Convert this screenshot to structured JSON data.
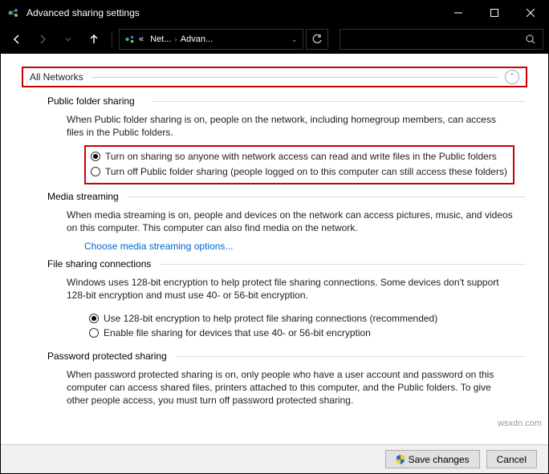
{
  "window": {
    "title": "Advanced sharing settings"
  },
  "breadcrumbs": {
    "prefix": "«",
    "net": "Net...",
    "advan": "Advan..."
  },
  "profile": {
    "label": "All Networks"
  },
  "public_folder": {
    "title": "Public folder sharing",
    "desc": "When Public folder sharing is on, people on the network, including homegroup members, can access files in the Public folders.",
    "opt_on": "Turn on sharing so anyone with network access can read and write files in the Public folders",
    "opt_off": "Turn off Public folder sharing (people logged on to this computer can still access these folders)"
  },
  "media_streaming": {
    "title": "Media streaming",
    "desc": "When media streaming is on, people and devices on the network can access pictures, music, and videos on this computer. This computer can also find media on the network.",
    "link": "Choose media streaming options..."
  },
  "file_sharing": {
    "title": "File sharing connections",
    "desc": "Windows uses 128-bit encryption to help protect file sharing connections. Some devices don't support 128-bit encryption and must use 40- or 56-bit encryption.",
    "opt_128": "Use 128-bit encryption to help protect file sharing connections (recommended)",
    "opt_40": "Enable file sharing for devices that use 40- or 56-bit encryption"
  },
  "password": {
    "title": "Password protected sharing",
    "desc": "When password protected sharing is on, only people who have a user account and password on this computer can access shared files, printers attached to this computer, and the Public folders. To give other people access, you must turn off password protected sharing."
  },
  "footer": {
    "save": "Save changes",
    "cancel": "Cancel"
  },
  "watermark": "wsxdn.com"
}
